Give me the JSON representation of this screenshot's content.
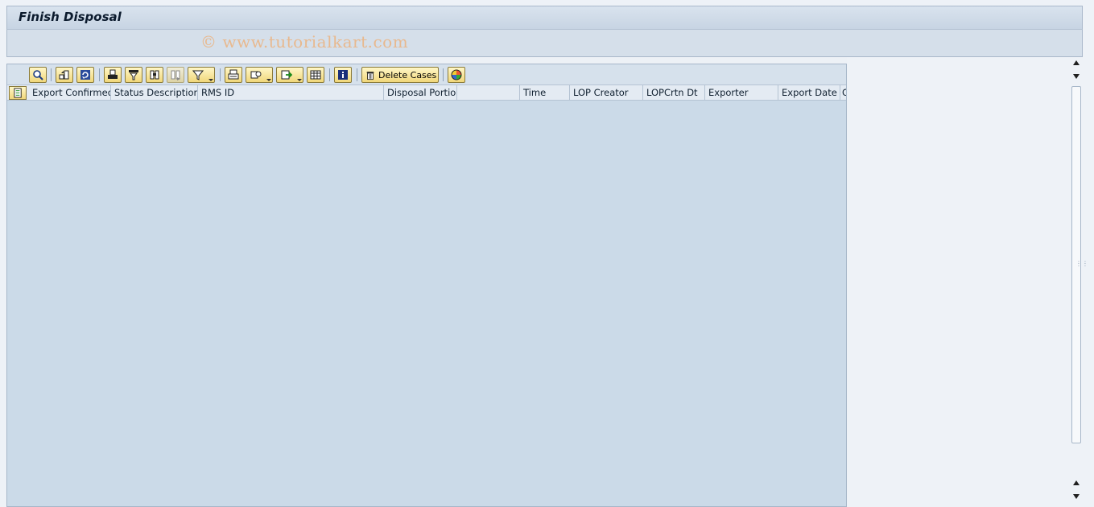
{
  "window": {
    "title": "Finish Disposal",
    "watermark": "© www.tutorialkart.com"
  },
  "toolbar": {
    "buttons": [
      {
        "name": "details",
        "icon": "magnifier-icon"
      },
      {
        "name": "sort-ascending",
        "icon": "sort-asc-icon"
      },
      {
        "name": "refresh",
        "icon": "refresh-icon"
      },
      {
        "name": "print-preview",
        "icon": "print-icon"
      },
      {
        "name": "filter",
        "icon": "filter-icon"
      },
      {
        "name": "find",
        "icon": "binoculars-icon"
      },
      {
        "name": "find-next",
        "icon": "binoculars-next-icon"
      },
      {
        "name": "set-filter",
        "icon": "funnel-icon"
      },
      {
        "name": "print",
        "icon": "printer-icon"
      },
      {
        "name": "views",
        "icon": "views-icon"
      },
      {
        "name": "export",
        "icon": "export-icon"
      },
      {
        "name": "layout",
        "icon": "grid-icon"
      },
      {
        "name": "info",
        "icon": "info-icon"
      },
      {
        "name": "graphic",
        "icon": "color-wheel-icon"
      }
    ],
    "delete_cases_label": "Delete Cases"
  },
  "table": {
    "columns": [
      "Export Confirmed",
      "Status Description",
      "RMS ID",
      "Disposal Portion",
      "",
      "Time",
      "LOP Creator",
      "LOPCrtn Dt",
      "Exporter",
      "Export Date",
      "C"
    ],
    "rows": []
  }
}
